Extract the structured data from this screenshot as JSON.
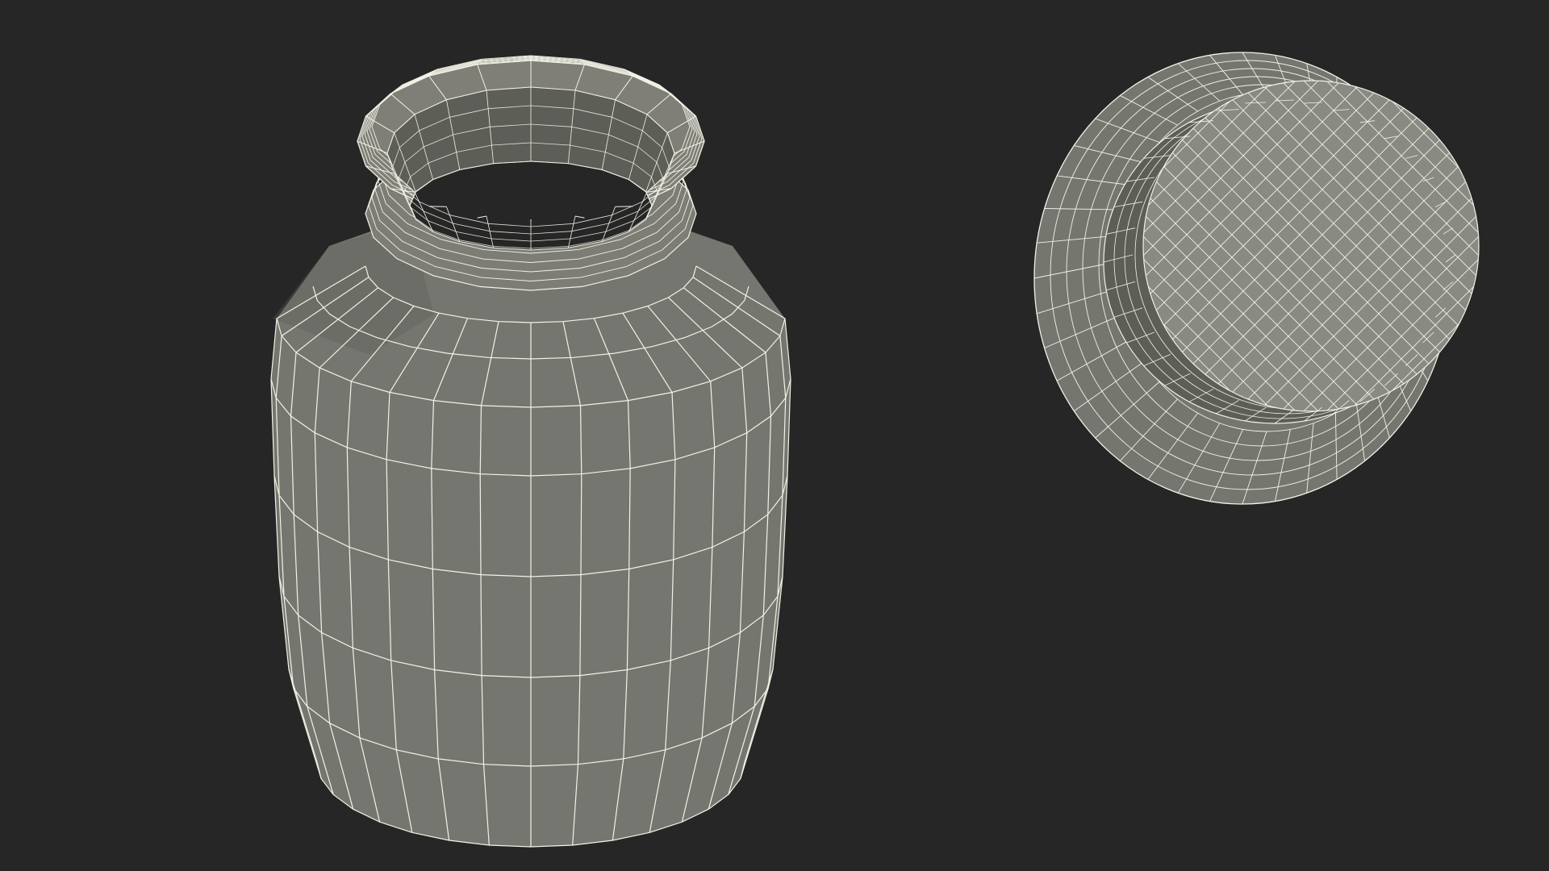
{
  "scene": {
    "background_color": "#262626",
    "mesh_fill_color": "#767670",
    "mesh_shadow_color": "#5e5e58",
    "mesh_highlight_color": "#8a8a84",
    "wire_color": "#f2f2e6",
    "objects": [
      {
        "name": "jar",
        "kind": "wireframe-mesh"
      },
      {
        "name": "lid",
        "kind": "wireframe-mesh"
      }
    ]
  }
}
